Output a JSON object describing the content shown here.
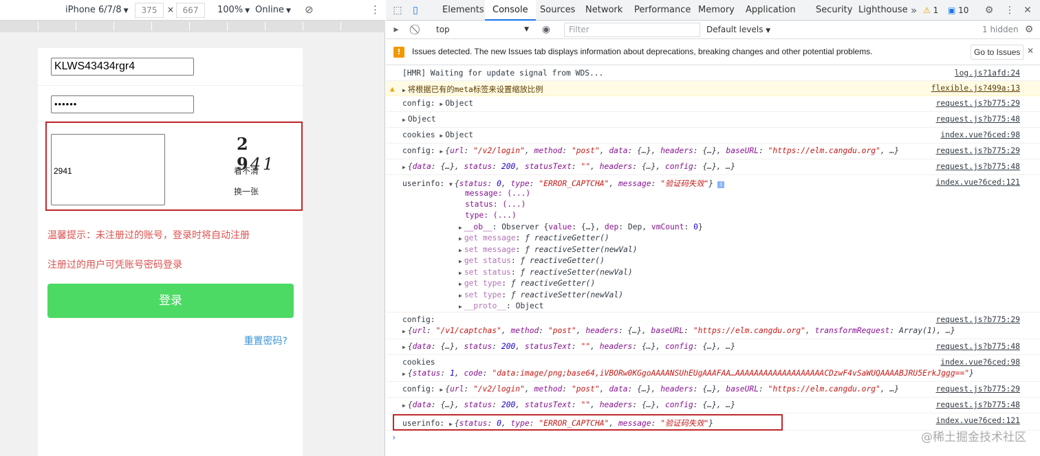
{
  "device_toolbar": {
    "device": "iPhone 6/7/8",
    "width": "375",
    "times": "×",
    "height": "667",
    "zoom": "100%",
    "network": "Online"
  },
  "login_form": {
    "username_value": "KLWS43434rgr4",
    "password_value": "••••••",
    "captcha_value": "2941",
    "captcha_image_digits": "2 9",
    "captcha_image_italic": "41",
    "unclear_label": "看不清",
    "refresh_label": "换一张",
    "tip_1": "温馨提示：未注册过的账号，登录时将自动注册",
    "tip_2": "注册过的用户可凭账号密码登录",
    "login_button": "登录",
    "reset_password": "重置密码?"
  },
  "devtools": {
    "tabs": [
      "Elements",
      "Console",
      "Sources",
      "Network",
      "Performance",
      "Memory",
      "Application",
      "Security",
      "Lighthouse"
    ],
    "more_tabs": "»",
    "warning_count": "1",
    "message_count": "10",
    "context": "top",
    "filter_placeholder": "Filter",
    "levels": "Default levels",
    "hidden": "1 hidden",
    "issues_text": "Issues detected. The new Issues tab displays information about deprecations, breaking changes and other potential problems.",
    "issues_button": "Go to Issues",
    "prompt": "›"
  },
  "console": {
    "m1": {
      "text": "[HMR] Waiting for update signal from WDS...",
      "src": "log.js?1afd:24"
    },
    "m2": {
      "text": "将根据已有的meta标签来设置缩放比例",
      "src": "flexible.js?499a:13"
    },
    "m3": {
      "label": "config:",
      "obj": "Object",
      "src": "request.js?b775:29"
    },
    "m4": {
      "obj": "Object",
      "src": "request.js?b775:48"
    },
    "m5": {
      "label": "cookies",
      "obj": "Object",
      "src": "index.vue?6ced:98"
    },
    "m6": {
      "label": "config:",
      "src": "request.js?b775:29"
    },
    "m7": {
      "src": "request.js?b775:48"
    },
    "m8": {
      "label": "userinfo:",
      "src": "index.vue?6ced:121",
      "props": [
        "message: (...)",
        "status: (...)",
        "type: (...)"
      ]
    },
    "m9": {
      "label": "config:",
      "src": "request.js?b775:29"
    },
    "m10": {
      "src": "request.js?b775:48"
    },
    "m11": {
      "label": "cookies",
      "src": "index.vue?6ced:98"
    },
    "m12": {
      "label": "config:",
      "src": "request.js?b775:29"
    },
    "m13": {
      "src": "request.js?b775:48"
    },
    "m14": {
      "label": "userinfo:",
      "src": "index.vue?6ced:121"
    }
  },
  "watermark": "@稀土掘金技术社区"
}
